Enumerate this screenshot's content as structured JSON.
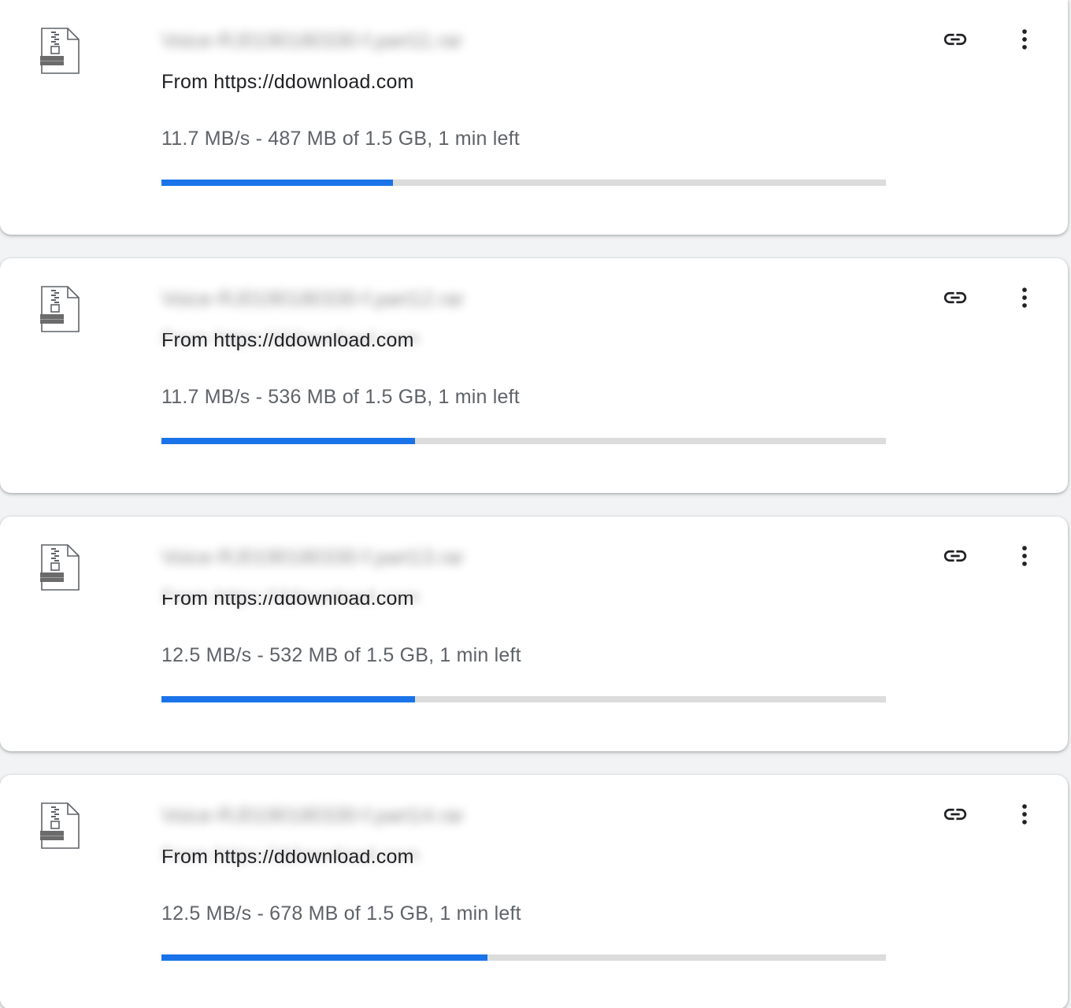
{
  "downloads": [
    {
      "file_name": "Voice-RJ0190180330-f.part11.rar",
      "source_label": "From https://ddownload.com",
      "status": "11.7 MB/s - 487 MB of 1.5 GB, 1 min left",
      "progress": 0.32,
      "file_type_icon": "archive-file-icon"
    },
    {
      "file_name": "Voice-RJ0190180330-f.part12.rar",
      "source_label": "From https://ddownload.com",
      "status": "11.7 MB/s - 536 MB of 1.5 GB, 1 min left",
      "progress": 0.35,
      "file_type_icon": "archive-file-icon"
    },
    {
      "file_name": "Voice-RJ0190180330-f.part13.rar",
      "source_label": "From https://ddownload.com",
      "status": "12.5 MB/s - 532 MB of 1.5 GB, 1 min left",
      "progress": 0.35,
      "file_type_icon": "archive-file-icon"
    },
    {
      "file_name": "Voice-RJ0190180330-f.part14.rar",
      "source_label": "From https://ddownload.com",
      "status": "12.5 MB/s - 678 MB of 1.5 GB, 1 min left",
      "progress": 0.45,
      "file_type_icon": "archive-file-icon"
    }
  ],
  "actions": {
    "copy_link_icon": "link-icon",
    "more_icon": "more-vert-icon"
  },
  "colors": {
    "progress_fill": "#1a73e8",
    "progress_track": "#dcdcdc",
    "card_bg": "#ffffff",
    "page_bg": "#f1f3f4"
  }
}
